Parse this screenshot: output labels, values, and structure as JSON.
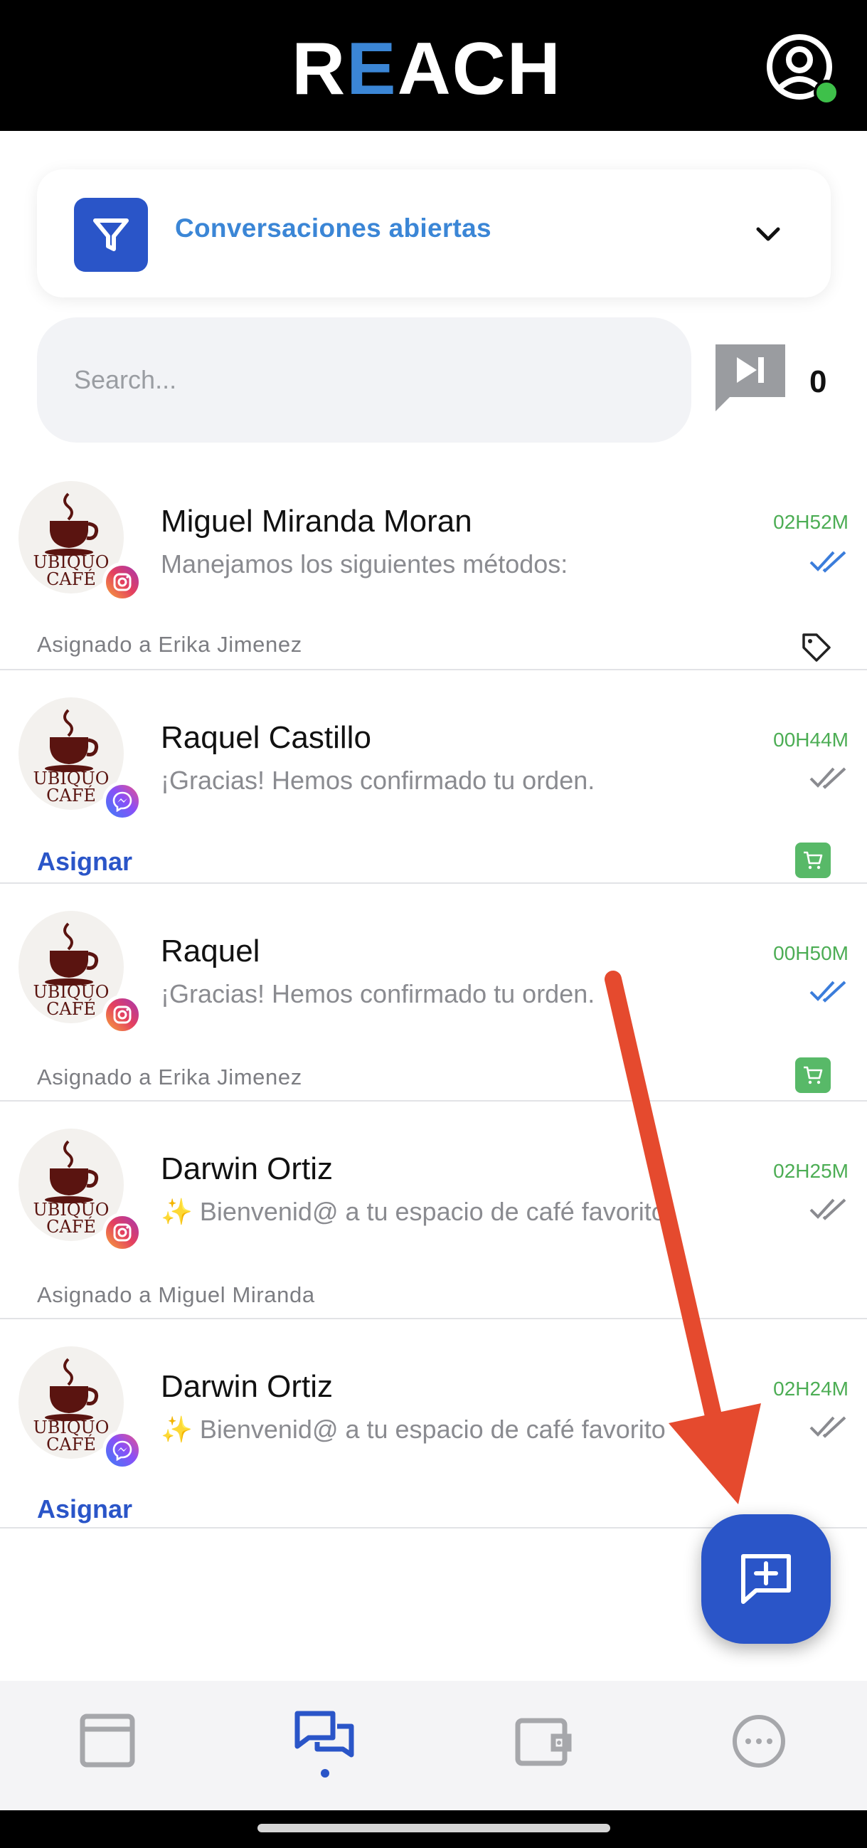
{
  "header": {
    "logo_text": "REACH",
    "accent_color": "#3b86d6",
    "status_color": "#3ec04a"
  },
  "filter": {
    "label": "Conversaciones abiertas",
    "icon": "filter-icon",
    "dropdown_icon": "chevron-down-icon"
  },
  "search": {
    "placeholder": "Search...",
    "value": ""
  },
  "queue": {
    "icon": "skip-next-icon",
    "count": "0"
  },
  "conversations": [
    {
      "name": "Miguel Miranda Moran",
      "message": "Manejamos los siguientes métodos:",
      "time": "02H52M",
      "channel": "instagram",
      "read": true,
      "assignment": "Asignado a Erika Jimenez",
      "assign_action": "",
      "flag_icon": "tag-icon"
    },
    {
      "name": "Raquel Castillo",
      "message": "¡Gracias! Hemos confirmado tu orden.",
      "time": "00H44M",
      "channel": "messenger",
      "read": false,
      "assignment": "",
      "assign_action": "Asignar",
      "flag_icon": "cart-icon"
    },
    {
      "name": "Raquel",
      "message": "¡Gracias! Hemos confirmado tu orden.",
      "time": "00H50M",
      "channel": "instagram",
      "read": true,
      "assignment": "Asignado a Erika Jimenez",
      "assign_action": "",
      "flag_icon": "cart-icon"
    },
    {
      "name": "Darwin Ortiz",
      "message": "✨ Bienvenid@ a tu espacio de café favorito",
      "time": "02H25M",
      "channel": "instagram",
      "read": false,
      "assignment": "Asignado a Miguel Miranda",
      "assign_action": "",
      "flag_icon": ""
    },
    {
      "name": "Darwin Ortiz",
      "message": "✨ Bienvenid@ a tu espacio de café favorito",
      "time": "02H24M",
      "channel": "messenger",
      "read": false,
      "assignment": "",
      "assign_action": "Asignar",
      "flag_icon": ""
    }
  ],
  "avatar": {
    "line1": "UBIQUO",
    "line2": "CAFÉ",
    "brand_color": "#5a1410"
  },
  "fab": {
    "icon": "new-message-icon"
  },
  "bottom_nav": {
    "items": [
      "window-icon",
      "chat-bubbles-icon",
      "wallet-icon",
      "more-icon"
    ],
    "active": "chat-bubbles-icon"
  }
}
